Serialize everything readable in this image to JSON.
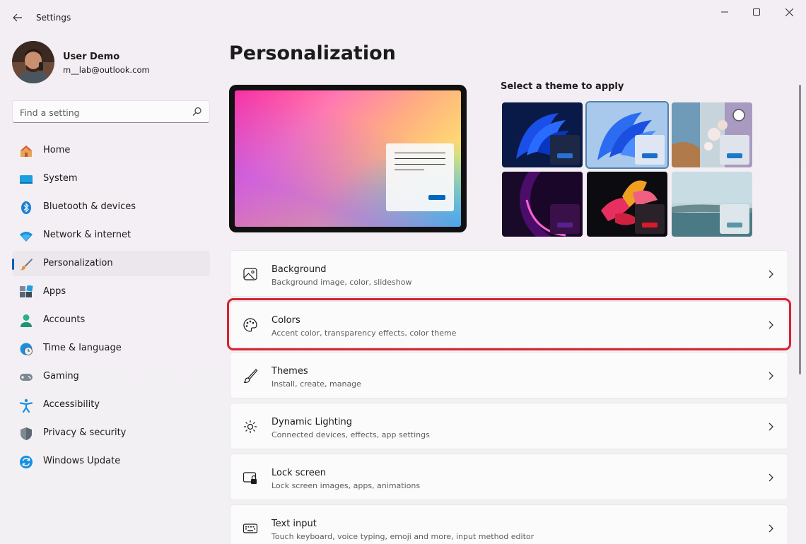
{
  "window": {
    "title": "Settings"
  },
  "profile": {
    "name": "User Demo",
    "email": "m__lab@outlook.com"
  },
  "search": {
    "placeholder": "Find a setting"
  },
  "nav": {
    "items": [
      {
        "label": "Home",
        "icon": "home-icon"
      },
      {
        "label": "System",
        "icon": "system-icon"
      },
      {
        "label": "Bluetooth & devices",
        "icon": "bluetooth-icon"
      },
      {
        "label": "Network & internet",
        "icon": "wifi-icon"
      },
      {
        "label": "Personalization",
        "icon": "brush-icon",
        "active": true
      },
      {
        "label": "Apps",
        "icon": "apps-icon"
      },
      {
        "label": "Accounts",
        "icon": "person-icon"
      },
      {
        "label": "Time & language",
        "icon": "clock-globe-icon"
      },
      {
        "label": "Gaming",
        "icon": "controller-icon"
      },
      {
        "label": "Accessibility",
        "icon": "accessibility-icon"
      },
      {
        "label": "Privacy & security",
        "icon": "shield-icon"
      },
      {
        "label": "Windows Update",
        "icon": "update-icon"
      }
    ]
  },
  "main": {
    "title": "Personalization",
    "theme_heading": "Select a theme to apply",
    "settings": [
      {
        "title": "Background",
        "desc": "Background image, color, slideshow",
        "icon": "image-icon"
      },
      {
        "title": "Colors",
        "desc": "Accent color, transparency effects, color theme",
        "icon": "palette-icon",
        "highlighted": true
      },
      {
        "title": "Themes",
        "desc": "Install, create, manage",
        "icon": "brush-icon"
      },
      {
        "title": "Dynamic Lighting",
        "desc": "Connected devices, effects, app settings",
        "icon": "lighting-icon"
      },
      {
        "title": "Lock screen",
        "desc": "Lock screen images, apps, animations",
        "icon": "lock-screen-icon"
      },
      {
        "title": "Text input",
        "desc": "Touch keyboard, voice typing, emoji and more, input method editor",
        "icon": "keyboard-icon"
      }
    ]
  },
  "colors": {
    "accent": "#005fb8",
    "highlight_border": "#d7222f"
  }
}
